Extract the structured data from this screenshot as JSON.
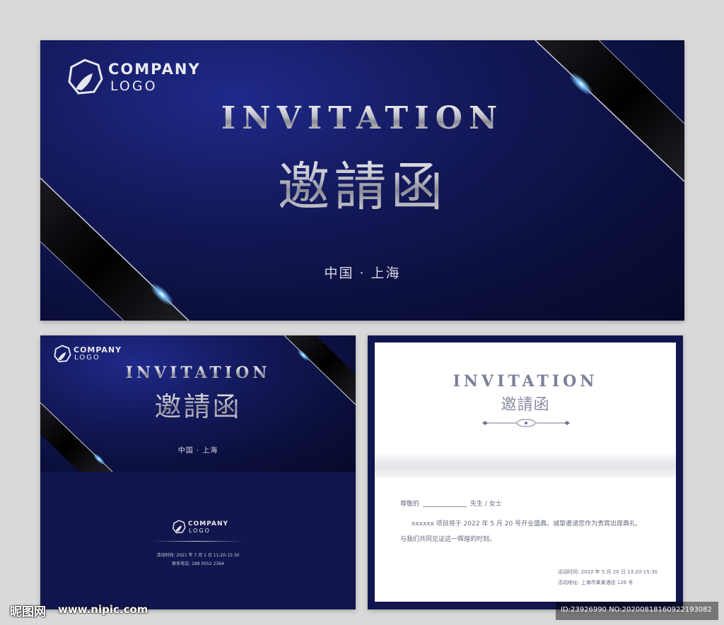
{
  "brand": {
    "company": "COMPANY",
    "logo": "LOGO"
  },
  "main_card": {
    "title_en": "INVITATION",
    "title_cn": "邀請函",
    "location": "中国 · 上海"
  },
  "front_card": {
    "title_en": "INVITATION",
    "title_cn": "邀請函",
    "location": "中国 · 上海",
    "event_time": "活动时间: 2021 年 7 月 1 日 11:20-15:30",
    "contact": "联系电话: 188 0552 2364"
  },
  "letter_card": {
    "title_en": "INVITATION",
    "title_cn": "邀請函",
    "salutation_prefix": "尊敬的",
    "salutation_suffix": "先生 / 女士",
    "body_line1": "xxxxxx 项目将于 2022 年 5 月 20 号开业盛典。诚挚邀请您作为贵宾出席典礼,",
    "body_line2": "与我们共同见证这一辉煌的时刻。",
    "event_time": "活动时间: 2022 年 5 月 20 日 13:20-15:30",
    "event_address": "活动地址: 上海市某某酒店 126 号"
  },
  "watermark": {
    "site_cn": "昵图网",
    "site_url": "www.nipic.com",
    "id_text": "ID:23926990 NO:20200818160922193082"
  },
  "colors": {
    "navy": "#0b0f3c",
    "silver": "#c8c8d0",
    "page_bg": "#d9d9d9",
    "accent_blue": "#5fb2ff"
  }
}
